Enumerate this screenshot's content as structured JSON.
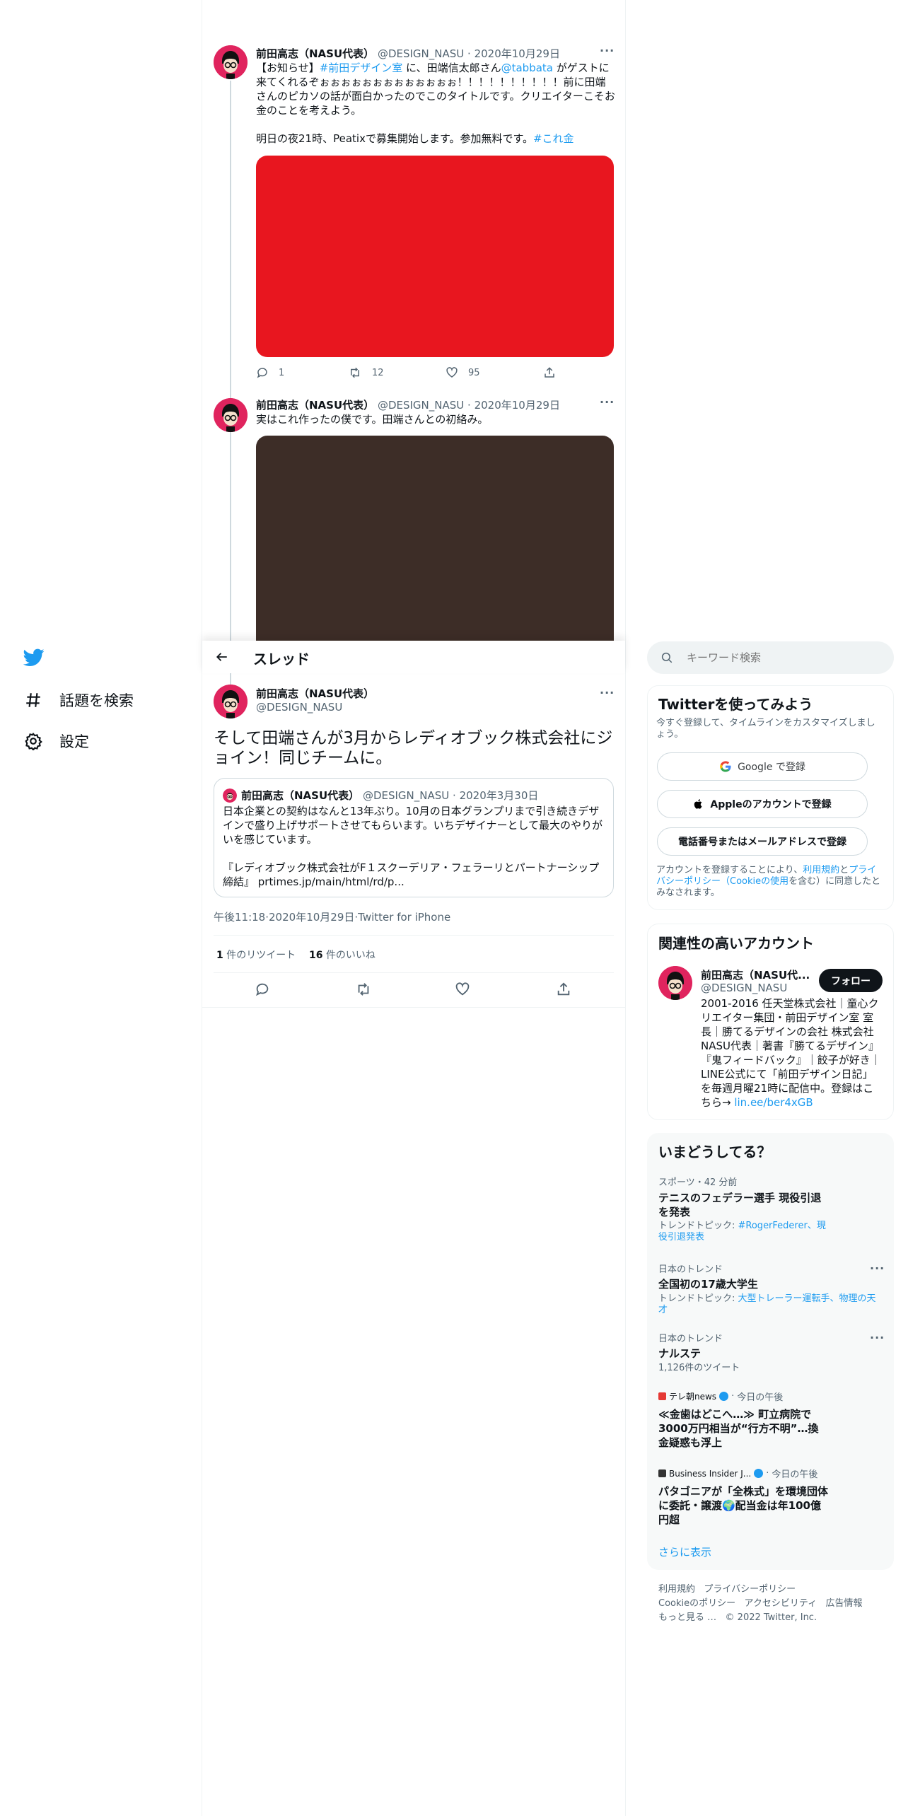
{
  "sidebar": {
    "items": [
      {
        "label": "話題を検索",
        "icon": "hashtag-icon"
      },
      {
        "label": "設定",
        "icon": "gear-icon"
      }
    ]
  },
  "header": {
    "title": "スレッド"
  },
  "tweets": [
    {
      "name": "前田高志（NASU代表）",
      "handle": "@DESIGN_NASU",
      "date": "2020年10月29日",
      "text_parts": {
        "p1": "【お知らせ】",
        "tag1": "#前田デザイン室",
        "p2": " に、田端信太郎さん",
        "mention": "@tabbata",
        "p3": " がゲストに来てくれるぞぉぉぉぉぉぉぉぉぉぉぉぉぉ！！！！！！！！！！前に田端さんのピカソの話が面白かったのでこのタイトルです。クリエイターこそお金のことを考えよう。",
        "p4": "明日の夜21時、Peatixで募集開始します。参加無料です。",
        "tag2": "#これ金"
      },
      "replies": "1",
      "retweets": "12",
      "likes": "95",
      "media_color": "#e8161f"
    },
    {
      "name": "前田高志（NASU代表）",
      "handle": "@DESIGN_NASU",
      "date": "2020年10月29日",
      "text": "実はこれ作ったの僕です。田端さんとの初絡み。",
      "media_color": "#3d2d27"
    }
  ],
  "main_tweet": {
    "name": "前田高志（NASU代表）",
    "handle": "@DESIGN_NASU",
    "text": "そして田端さんが3月からレディオブック株式会社にジョイン！同じチームに。",
    "quote": {
      "name": "前田高志（NASU代表）",
      "handle": "@DESIGN_NASU",
      "date": "2020年3月30日",
      "text1": "日本企業との契約はなんと13年ぶり。10月の日本グランプリまで引き続きデザインで盛り上げサポートさせてもらいます。いちデザイナーとして最大のやりがいを感じています。",
      "text2": "『レディオブック株式会社がF１スクーデリア・フェラーリとパートナーシップ締結』 prtimes.jp/main/html/rd/p..."
    },
    "time": "午後11:18",
    "date": "2020年10月29日",
    "source": "Twitter for iPhone",
    "retweet_count": "1",
    "retweet_label": "件のリツイート",
    "like_count": "16",
    "like_label": "件のいいね"
  },
  "search": {
    "placeholder": "キーワード検索"
  },
  "signup": {
    "title": "Twitterを使ってみよう",
    "subtitle": "今すぐ登録して、タイムラインをカスタマイズしましょう。",
    "google": "Google で登録",
    "apple": "Appleのアカウントで登録",
    "phone": "電話番号またはメールアドレスで登録",
    "terms_prefix": "アカウントを登録することにより、",
    "terms_link": "利用規約",
    "terms_mid": "と",
    "privacy_link": "プライバシーポリシー（Cookieの使用",
    "terms_suffix": "を含む）に同意したとみなされます。"
  },
  "related": {
    "title": "関連性の高いアカウント",
    "name": "前田高志（NASU代...",
    "handle": "@DESIGN_NASU",
    "follow": "フォロー",
    "bio": "2001-2016 任天堂株式会社｜童心クリエイター集団・前田デザイン室 室長｜勝てるデザインの会社 株式会社NASU代表｜著書『勝てるデザイン』『鬼フィードバック』｜餃子が好き｜LINE公式にて「前田デザイン日記」を毎週月曜21時に配信中。登録はこちら→ ",
    "bio_link": "lin.ee/ber4xGB"
  },
  "trends": {
    "title": "いまどうしてる？",
    "items": [
      {
        "meta": "スポーツ・42 分前",
        "title": "テニスのフェデラー選手 現役引退を発表",
        "sub_prefix": "トレンドトピック: ",
        "sub_links": "#RogerFederer、現役引退発表"
      },
      {
        "meta": "日本のトレンド",
        "title": "全国初の17歳大学生",
        "sub_prefix": "トレンドトピック: ",
        "sub_links": "大型トレーラー運転手、物理の天才"
      },
      {
        "meta": "日本のトレンド",
        "title": "ナルステ",
        "sub": "1,126件のツイート"
      },
      {
        "source": "テレ朝news",
        "time": "今日の午後",
        "title": "≪金歯はどこへ…≫ 町立病院で3000万円相当が“行方不明”…換金疑惑も浮上"
      },
      {
        "source": "Business Insider J...",
        "time": "今日の午後",
        "title": "パタゴニアが「全株式」を環境団体に委託・譲渡🌍配当金は年100億円超"
      }
    ],
    "more": "さらに表示"
  },
  "footer": {
    "links": [
      "利用規約",
      "プライバシーポリシー",
      "Cookieのポリシー",
      "アクセシビリティ",
      "広告情報",
      "もっと見る …"
    ],
    "copyright": "© 2022 Twitter, Inc."
  },
  "colors": {
    "accent": "#1d9bf0",
    "avatar_bg": "#e0245e",
    "text": "#0f1419",
    "muted": "#536471"
  }
}
